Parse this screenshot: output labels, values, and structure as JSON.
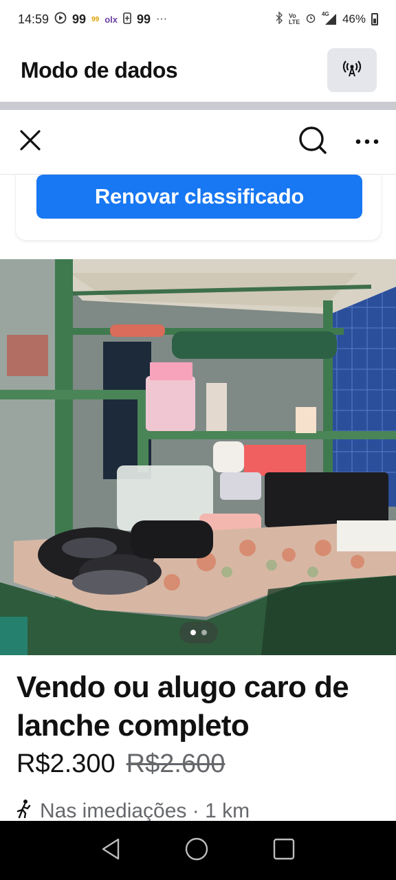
{
  "status_bar": {
    "time": "14:59",
    "badge_99_a": "99",
    "badge_99_small": "99",
    "olx": "olx",
    "badge_99_b": "99",
    "more": "···",
    "network_label": "Vo LTE",
    "network_type": "4G",
    "battery": "46%"
  },
  "data_mode": {
    "title": "Modo de dados",
    "signal_icon": "broadcast-icon"
  },
  "nav": {
    "close_icon": "close-icon",
    "search_icon": "search-icon",
    "more_icon": "more-icon"
  },
  "renew": {
    "label": "Renovar classificado",
    "color": "#1877f2"
  },
  "carousel": {
    "current": 1,
    "total": 2
  },
  "listing": {
    "title": "Vendo ou alugo caro de lanche completo",
    "price": "R$2.300",
    "old_price": "R$2.600",
    "location": "Nas imediações · 1 km"
  },
  "android_nav": {
    "back_icon": "back-icon",
    "home_icon": "home-icon",
    "recents_icon": "recents-icon"
  }
}
